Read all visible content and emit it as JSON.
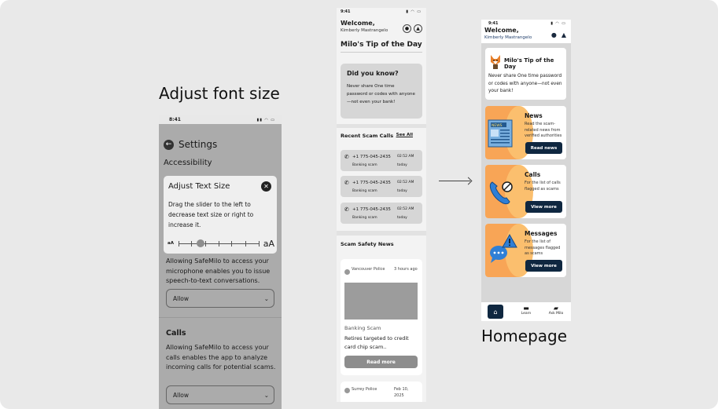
{
  "labels": {
    "adjust_font_size": "Adjust font size",
    "homepage": "Homepage"
  },
  "settings_screen": {
    "status_time": "8:41",
    "title": "Settings",
    "section": "Accessibility",
    "modal": {
      "title": "Adjust Text Size",
      "body": "Drag the slider to the left to decrease text size or right to increase it.",
      "small_label": "aA",
      "large_label": "aA",
      "slider_level_percent": 27
    },
    "microphone": {
      "description": "Allowing SafeMilo to access your microphone enables you to issue speech-to-text conversations.",
      "dropdown_value": "Allow"
    },
    "calls": {
      "title": "Calls",
      "description": "Allowing SafeMilo to access your calls enables the app to analyze incoming calls for potential scams.",
      "dropdown_value": "Allow"
    }
  },
  "wire_screen": {
    "status_time": "9:41",
    "welcome": "Welcome,",
    "user_name": "Kimberly Mastrangelo",
    "tip_heading": "Milo's Tip of the Day",
    "tip_card": {
      "title": "Did you know?",
      "body": "Never share One time password or codes with anyone—not even your bank!"
    },
    "recent_calls_title": "Recent Scam Calls",
    "see_all": "See All",
    "calls": [
      {
        "number": "+1 775-045-2435",
        "label": "Banking scam",
        "time": "02:52 AM",
        "day": "today"
      },
      {
        "number": "+1 775-045-2435",
        "label": "Banking scam",
        "time": "02:52 AM",
        "day": "today"
      },
      {
        "number": "+1 775-045-2435",
        "label": "Banking scam",
        "time": "02:52 AM",
        "day": "today"
      }
    ],
    "news_title": "Scam Safety News",
    "news": [
      {
        "source": "Vancouver Police",
        "time": "3 hours ago",
        "category": "Banking Scam",
        "headline": "Retires targeted to credit card chip scam..",
        "button": "Read more"
      },
      {
        "source": "Surrey Police",
        "time": "Feb 10, 2025"
      }
    ]
  },
  "home_screen": {
    "status_time": "9:41",
    "welcome": "Welcome,",
    "user_name": "Kimberly Mastrangelo",
    "tip": {
      "title": "Milo's Tip of the Day",
      "body": "Never share One time password or codes with anyone—not even your bank!"
    },
    "news_badge": "NEWS",
    "features": [
      {
        "title": "News",
        "description": "Read the scam-related news from verified authorities",
        "button": "Read news",
        "icon": "newspaper-icon"
      },
      {
        "title": "Calls",
        "description": "For the list of calls flagged as scams",
        "button": "View more",
        "icon": "phone-blocked-icon"
      },
      {
        "title": "Messages",
        "description": "For the list of messages flagged as scams",
        "button": "View more",
        "icon": "message-alert-icon"
      }
    ],
    "nav": [
      {
        "label": "",
        "icon": "home-icon"
      },
      {
        "label": "Learn",
        "icon": "book-icon"
      },
      {
        "label": "Ask Milo",
        "icon": "chat-icon"
      }
    ],
    "colors": {
      "primary": "#0f2740",
      "accent_orange": "#f8a556"
    }
  }
}
